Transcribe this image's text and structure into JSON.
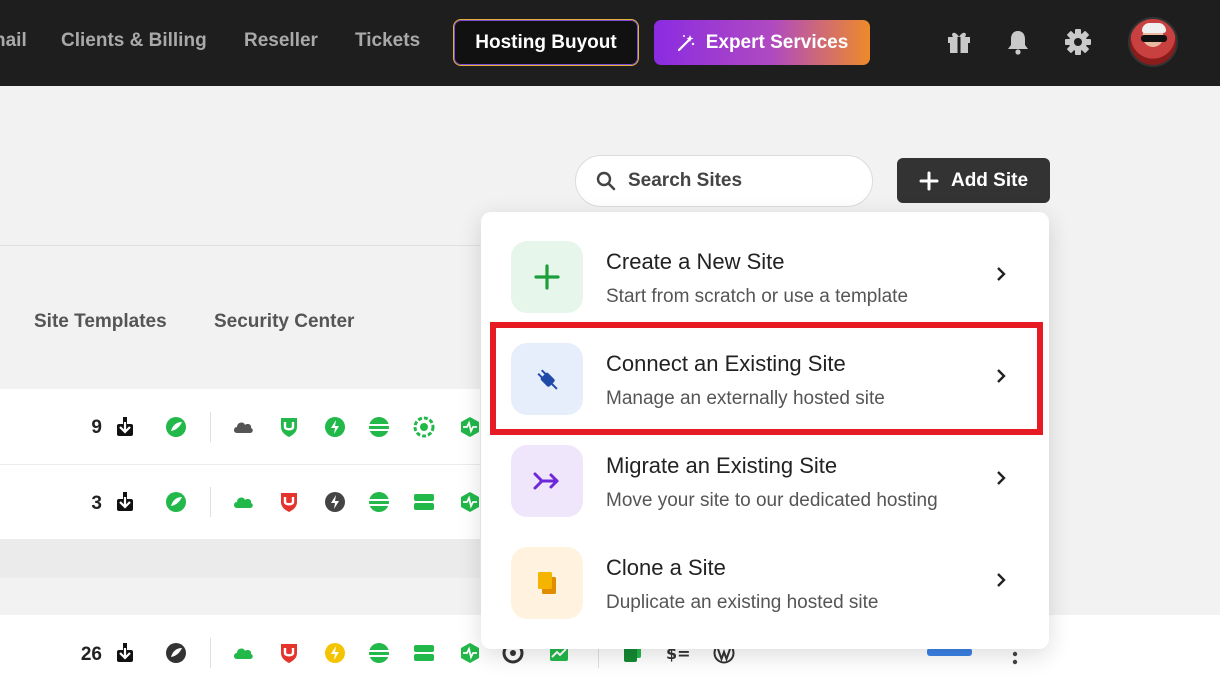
{
  "topbar": {
    "nav": [
      "nail",
      "Clients & Billing",
      "Reseller",
      "Tickets"
    ],
    "hosting_buyout": "Hosting Buyout",
    "expert_services": "Expert Services",
    "icons": [
      "gift-icon",
      "bell-icon",
      "gear-icon",
      "avatar"
    ]
  },
  "search": {
    "placeholder": "Search Sites"
  },
  "add_site": {
    "label": "Add Site"
  },
  "tabs": [
    "Site Templates",
    "Security Center"
  ],
  "rows": [
    {
      "count": "9"
    },
    {
      "count": "3"
    },
    {
      "count": "26"
    }
  ],
  "dropdown": {
    "items": [
      {
        "title": "Create a New Site",
        "subtitle": "Start from scratch or use a template",
        "icon": "plus-icon",
        "bg": "#e6f6ea",
        "color": "#1e9e3a"
      },
      {
        "title": "Connect an Existing Site",
        "subtitle": "Manage an externally hosted site",
        "icon": "plug-icon",
        "bg": "#e6eefb",
        "color": "#1f4aa8"
      },
      {
        "title": "Migrate an Existing Site",
        "subtitle": "Move your site to our dedicated hosting",
        "icon": "migrate-icon",
        "bg": "#efe6fb",
        "color": "#6d28d9"
      },
      {
        "title": "Clone a Site",
        "subtitle": "Duplicate an existing hosted site",
        "icon": "copy-icon",
        "bg": "#fff3e0",
        "color": "#f0a000"
      }
    ]
  },
  "colors": {
    "green": "#22b84a",
    "red": "#e5342b",
    "yellow": "#f5c400",
    "dark": "#333333",
    "highlight": "#e61b23"
  }
}
